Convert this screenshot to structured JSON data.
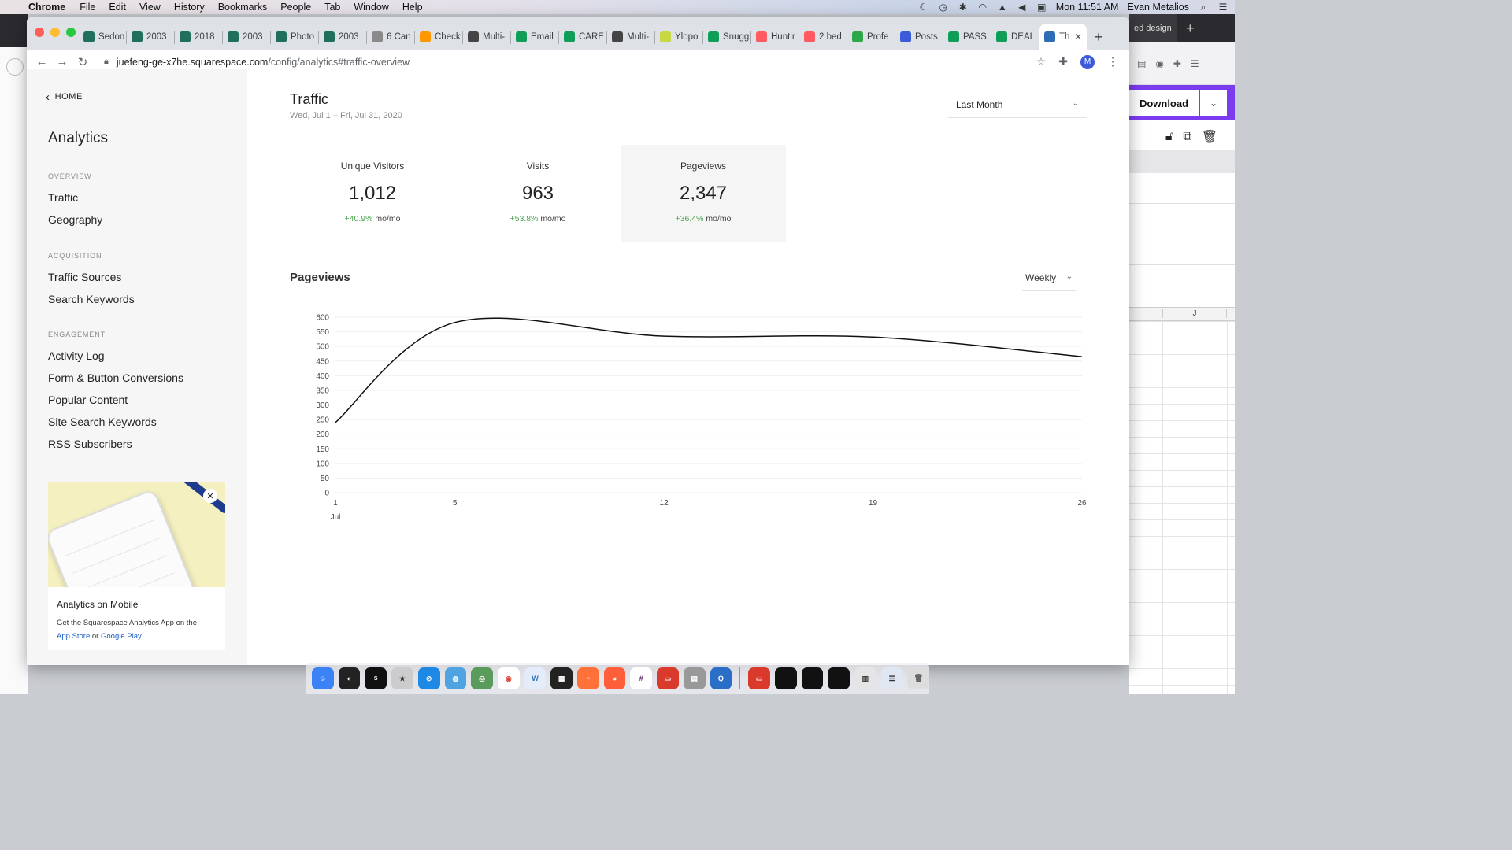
{
  "menubar": {
    "app_name": "Chrome",
    "items": [
      "File",
      "Edit",
      "View",
      "History",
      "Bookmarks",
      "People",
      "Tab",
      "Window",
      "Help"
    ],
    "clock": "Mon 11:51 AM",
    "user": "Evan Metalios"
  },
  "browser": {
    "tabs": [
      {
        "label": "Sedon",
        "icon": "o-icon",
        "color": "#1f6f5c"
      },
      {
        "label": "2003",
        "icon": "o-icon",
        "color": "#1f6f5c"
      },
      {
        "label": "2018",
        "icon": "o-icon",
        "color": "#1f6f5c"
      },
      {
        "label": "2003",
        "icon": "o-icon",
        "color": "#1f6f5c"
      },
      {
        "label": "Photo",
        "icon": "o-icon",
        "color": "#1f6f5c"
      },
      {
        "label": "2003",
        "icon": "o-icon",
        "color": "#1f6f5c"
      },
      {
        "label": "6 Can",
        "icon": "star-icon",
        "color": "#8a8a8a"
      },
      {
        "label": "Check",
        "icon": "flag-icon",
        "color": "#ff9800"
      },
      {
        "label": "Multi-",
        "icon": "map-icon",
        "color": "#444444"
      },
      {
        "label": "Email",
        "icon": "sheet-icon",
        "color": "#0f9d58"
      },
      {
        "label": "CARE",
        "icon": "sheet-icon",
        "color": "#0f9d58"
      },
      {
        "label": "Multi-",
        "icon": "map-icon",
        "color": "#444444"
      },
      {
        "label": "Ylopo",
        "icon": "leaf-icon",
        "color": "#c8d840"
      },
      {
        "label": "Snugg",
        "icon": "sheet-icon",
        "color": "#0f9d58"
      },
      {
        "label": "Huntir",
        "icon": "airbnb-icon",
        "color": "#ff5a5f"
      },
      {
        "label": "2 bed",
        "icon": "airbnb-icon",
        "color": "#ff5a5f"
      },
      {
        "label": "Profe",
        "icon": "circle-icon",
        "color": "#2ca84a"
      },
      {
        "label": "Posts",
        "icon": "doc-icon",
        "color": "#3b5bdb"
      },
      {
        "label": "PASS",
        "icon": "sheet-icon",
        "color": "#0f9d58"
      },
      {
        "label": "DEAL",
        "icon": "sheet-icon",
        "color": "#0f9d58"
      },
      {
        "label": "Th",
        "icon": "m-icon",
        "color": "#2d6db5"
      }
    ],
    "url_host": "juefeng-ge-x7he.squarespace.com",
    "url_path": "/config/analytics#traffic-overview",
    "profile_initial": "M"
  },
  "sidebar": {
    "home_label": "HOME",
    "title": "Analytics",
    "sections": {
      "overview": "OVERVIEW",
      "acquisition": "ACQUISITION",
      "engagement": "ENGAGEMENT"
    },
    "overview_items": [
      "Traffic",
      "Geography"
    ],
    "acquisition_items": [
      "Traffic Sources",
      "Search Keywords"
    ],
    "engagement_items": [
      "Activity Log",
      "Form & Button Conversions",
      "Popular Content",
      "Site Search Keywords",
      "RSS Subscribers"
    ],
    "promo": {
      "title": "Analytics on Mobile",
      "text": "Get the Squarespace Analytics App on the",
      "link1": "App Store",
      "or": " or ",
      "link2": "Google Play",
      "end": "."
    }
  },
  "main": {
    "title": "Traffic",
    "date_range": "Wed, Jul 1 – Fri, Jul 31, 2020",
    "range_select": "Last Month",
    "stats": [
      {
        "label": "Unique Visitors",
        "value": "1,012",
        "change": "+40.9%",
        "suffix": "mo/mo"
      },
      {
        "label": "Visits",
        "value": "963",
        "change": "+53.8%",
        "suffix": "mo/mo"
      },
      {
        "label": "Pageviews",
        "value": "2,347",
        "change": "+36.4%",
        "suffix": "mo/mo"
      }
    ],
    "chart_title": "Pageviews",
    "interval_select": "Weekly"
  },
  "chart_data": {
    "type": "line",
    "title": "Pageviews",
    "x": [
      1,
      5,
      12,
      19,
      26
    ],
    "x_tick_labels": [
      "1",
      "5",
      "12",
      "19",
      "26"
    ],
    "x_month_label": "Jul",
    "series": [
      {
        "values": [
          240,
          582,
          535,
          532,
          465
        ]
      }
    ],
    "ylim": [
      0,
      600
    ],
    "y_ticks": [
      0,
      50,
      100,
      150,
      200,
      250,
      300,
      350,
      400,
      450,
      500,
      550,
      600
    ],
    "grid": true,
    "line_color": "#111111"
  },
  "background_app": {
    "tab_label": "ed design",
    "download_label": "Download",
    "column_label": "J"
  },
  "colors": {
    "positive": "#4aa24f",
    "link": "#1a5dc9",
    "accent_purple": "#7b3cf0"
  }
}
